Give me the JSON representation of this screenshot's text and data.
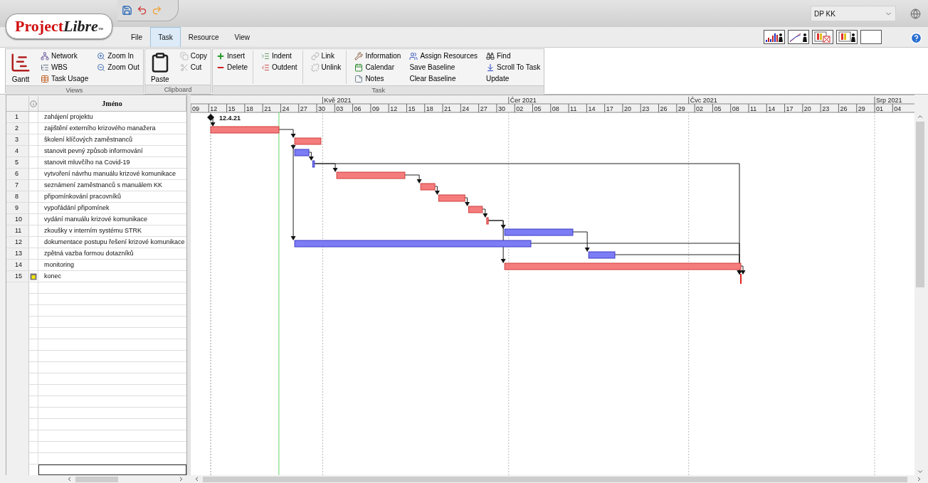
{
  "logo": {
    "main": "Project",
    "accent": "Libre",
    "mark": "™"
  },
  "tabs": [
    {
      "label": "File",
      "selected": false
    },
    {
      "label": "Task",
      "selected": true
    },
    {
      "label": "Resource",
      "selected": false
    },
    {
      "label": "View",
      "selected": false
    }
  ],
  "project_select": {
    "value": "DP KK"
  },
  "ribbon": {
    "groups": [
      {
        "label": "Views",
        "columns": [
          [
            {
              "label": "Gantt",
              "kind": "large"
            }
          ],
          [
            {
              "label": "Network",
              "kind": "small"
            },
            {
              "label": "WBS",
              "kind": "small"
            },
            {
              "label": "Task Usage",
              "kind": "small"
            }
          ],
          [
            {
              "label": "Zoom In",
              "kind": "small"
            },
            {
              "label": "Zoom Out",
              "kind": "small"
            }
          ]
        ]
      },
      {
        "label": "Clipboard",
        "columns": [
          [
            {
              "label": "Paste",
              "kind": "large"
            }
          ],
          [
            {
              "label": "Copy",
              "kind": "small"
            },
            {
              "label": "Cut",
              "kind": "small"
            }
          ]
        ]
      },
      {
        "label": "Task",
        "columns": [
          [
            {
              "label": "Insert",
              "kind": "small"
            },
            {
              "label": "Delete",
              "kind": "small"
            }
          ],
          [
            {
              "label": "Indent",
              "kind": "small"
            },
            {
              "label": "Outdent",
              "kind": "small"
            }
          ],
          [
            {
              "label": "Link",
              "kind": "small"
            },
            {
              "label": "Unlink",
              "kind": "small"
            }
          ],
          [
            {
              "label": "Information",
              "kind": "small"
            },
            {
              "label": "Calendar",
              "kind": "small"
            },
            {
              "label": "Notes",
              "kind": "small"
            }
          ],
          [
            {
              "label": "Assign Resources",
              "kind": "small"
            },
            {
              "label": "Save Baseline",
              "kind": "text"
            },
            {
              "label": "Clear Baseline",
              "kind": "text"
            }
          ],
          [
            {
              "label": "Find",
              "kind": "small"
            },
            {
              "label": "Scroll To Task",
              "kind": "small"
            },
            {
              "label": "Update",
              "kind": "text"
            }
          ]
        ]
      }
    ]
  },
  "table": {
    "name_header": "Jméno"
  },
  "tasks": [
    {
      "id": "1",
      "name": "zahájení projektu",
      "indicator": false,
      "bar": {
        "kind": "milestone",
        "critical": false,
        "label": "12.4.21"
      }
    },
    {
      "id": "2",
      "name": "zajištění externího krizového manažera",
      "indicator": false,
      "bar": {
        "kind": "task",
        "critical": true
      }
    },
    {
      "id": "3",
      "name": "školení klíčových zaměstnanců",
      "indicator": false,
      "bar": {
        "kind": "task",
        "critical": true
      }
    },
    {
      "id": "4",
      "name": "stanovit pevný způsob informování",
      "indicator": false,
      "bar": {
        "kind": "task",
        "critical": false
      }
    },
    {
      "id": "5",
      "name": "stanovit mluvčího na Covid-19",
      "indicator": false,
      "bar": {
        "kind": "task",
        "critical": false
      }
    },
    {
      "id": "6",
      "name": "vytvoření návrhu manuálu krizové komunikace",
      "indicator": false,
      "bar": {
        "kind": "task",
        "critical": true
      }
    },
    {
      "id": "7",
      "name": "seznámení zaměstnanců s manuálem KK",
      "indicator": false,
      "bar": {
        "kind": "task",
        "critical": true
      }
    },
    {
      "id": "8",
      "name": "připomínkování pracovníků",
      "indicator": false,
      "bar": {
        "kind": "task",
        "critical": true
      }
    },
    {
      "id": "9",
      "name": "vypořádání připomínek",
      "indicator": false,
      "bar": {
        "kind": "task",
        "critical": true
      }
    },
    {
      "id": "10",
      "name": "vydání manuálu krizové komunikace",
      "indicator": false,
      "bar": {
        "kind": "task",
        "critical": true
      }
    },
    {
      "id": "11",
      "name": "zkoušky v interním systému STRK",
      "indicator": false,
      "bar": {
        "kind": "task",
        "critical": false
      }
    },
    {
      "id": "12",
      "name": "dokumentace postupu řešení krizové komunikace",
      "indicator": false,
      "bar": {
        "kind": "task",
        "critical": false
      }
    },
    {
      "id": "13",
      "name": "zpětná vazba formou dotazníků",
      "indicator": false,
      "bar": {
        "kind": "task",
        "critical": false
      }
    },
    {
      "id": "14",
      "name": "monitoring",
      "indicator": false,
      "bar": {
        "kind": "task",
        "critical": true
      }
    },
    {
      "id": "15",
      "name": "konec",
      "indicator": true,
      "bar": {
        "kind": "milestone",
        "critical": true
      }
    }
  ],
  "gantt": {
    "months": [
      "Kvě 2021",
      "Čer 2021",
      "Čvc 2021",
      "Srp 2021"
    ],
    "day_ticks": [
      "09",
      "12",
      "15",
      "18",
      "21",
      "24",
      "27",
      "30",
      "03",
      "06",
      "09",
      "12",
      "15",
      "18",
      "21",
      "24",
      "27",
      "30",
      "02",
      "05",
      "08",
      "11",
      "14",
      "17",
      "20",
      "23",
      "26",
      "29",
      "02",
      "05",
      "08",
      "11",
      "14",
      "17",
      "20",
      "23",
      "26",
      "29",
      "01",
      "04"
    ]
  }
}
